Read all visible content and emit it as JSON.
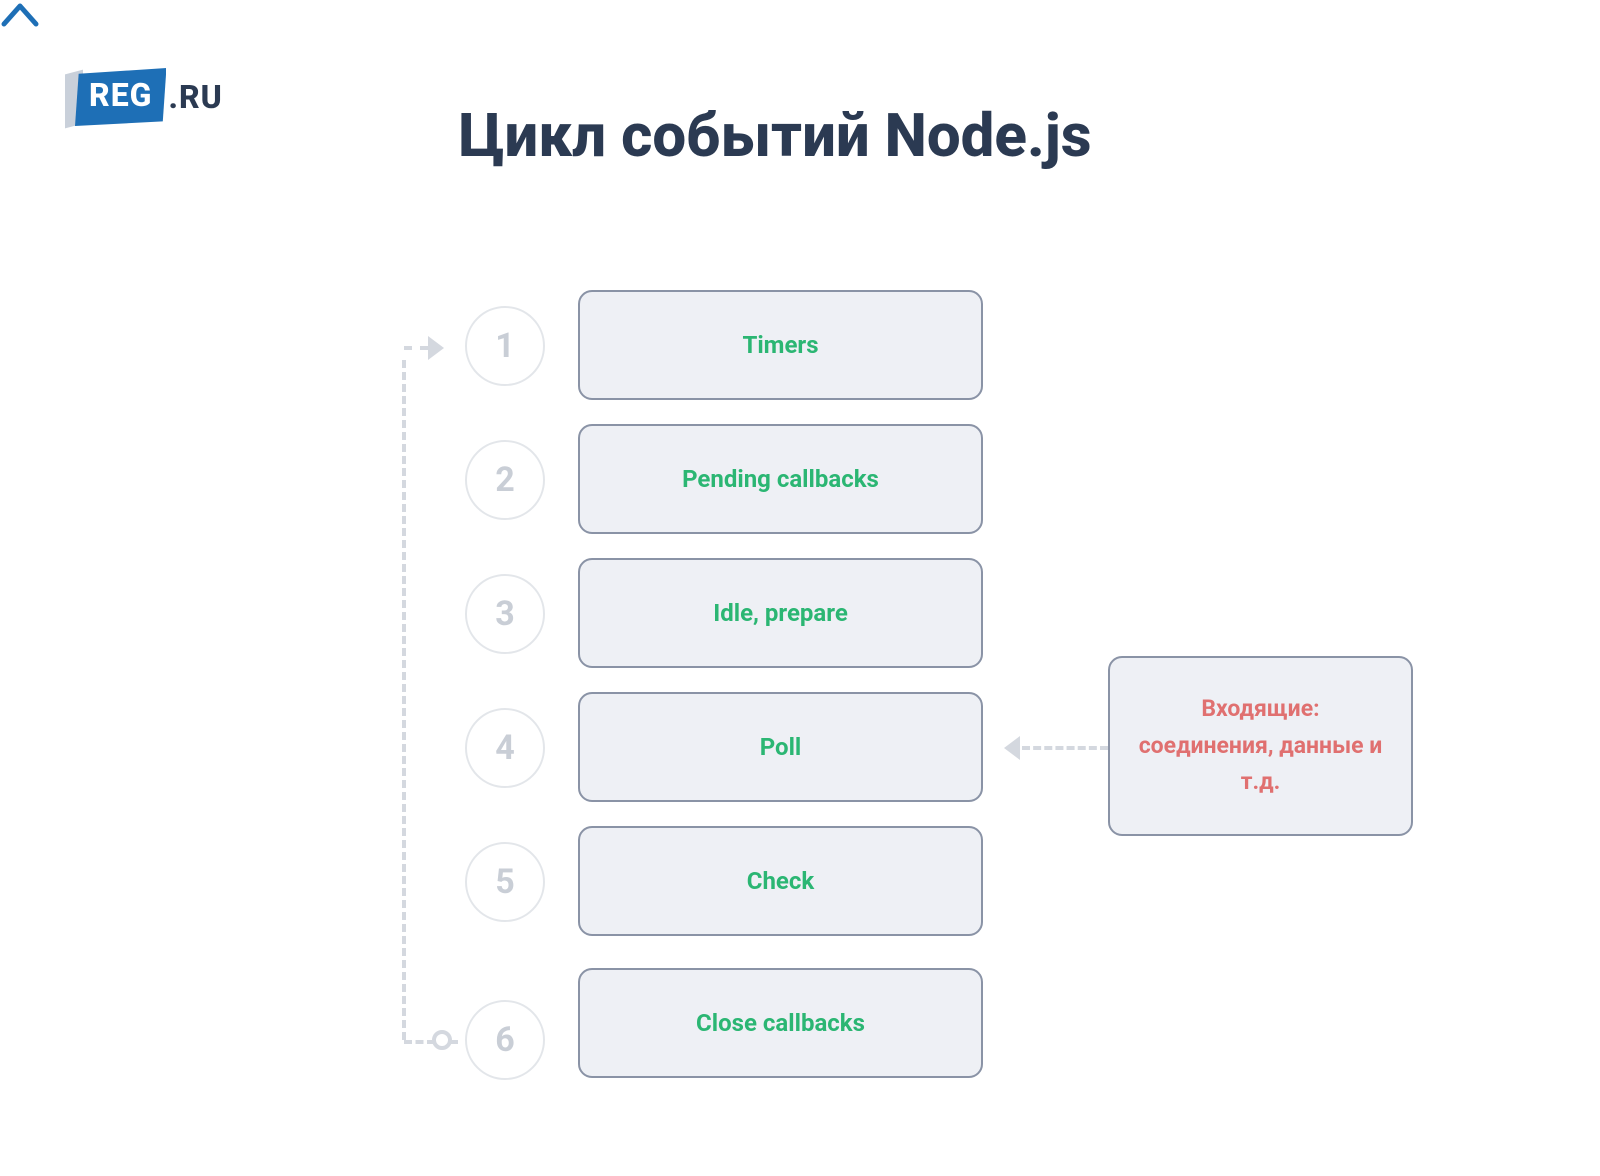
{
  "chevron_label": "chevron-up",
  "logo": {
    "badge": "REG",
    "suffix": ".RU"
  },
  "title": "Цикл событий Node.js",
  "phases": [
    {
      "num": "1",
      "label": "Timers"
    },
    {
      "num": "2",
      "label": "Pending callbacks"
    },
    {
      "num": "3",
      "label": "Idle, prepare"
    },
    {
      "num": "4",
      "label": "Poll"
    },
    {
      "num": "5",
      "label": "Check"
    },
    {
      "num": "6",
      "label": "Close callbacks"
    }
  ],
  "incoming": "Входящие: соединения, данные и т.д.",
  "colors": {
    "title": "#2b3a52",
    "phase_text": "#2bb673",
    "incoming_text": "#e07070",
    "box_border": "#8a93a6",
    "box_bg": "#eef0f5",
    "circle_border": "#e3e6ea",
    "circle_text": "#c9ced6",
    "dashed": "#d4d8df"
  }
}
